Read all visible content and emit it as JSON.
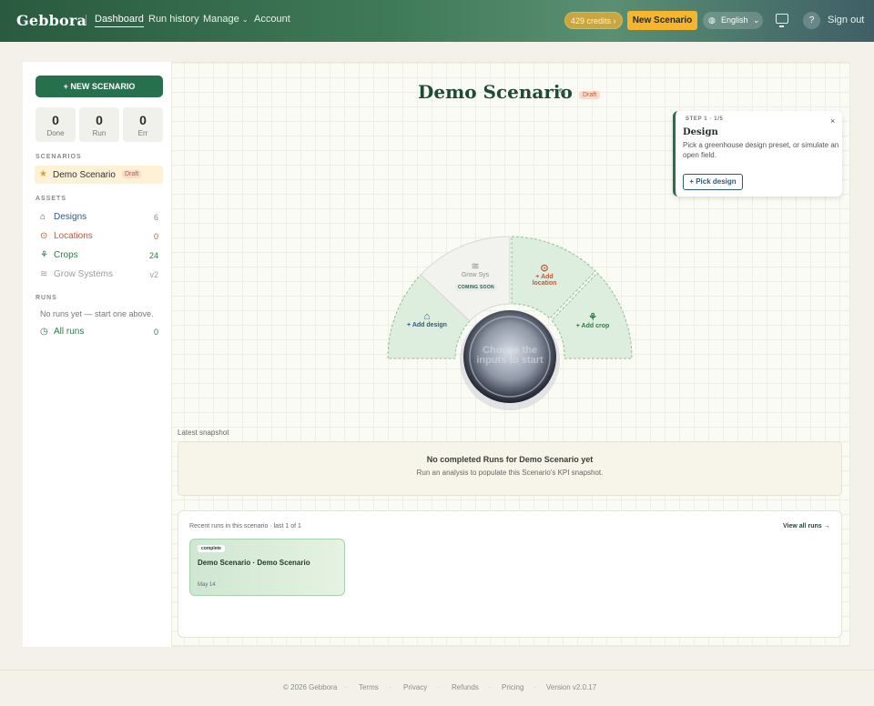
{
  "topbar": {
    "logo": "Gebbora",
    "nav": [
      "Dashboard",
      "Run history",
      "Manage",
      "Account"
    ],
    "credits": "429 credits ›",
    "new_scenario": "New Scenario",
    "language": "English",
    "help": "?",
    "sign_out": "Sign out",
    "brand_color": "#2f6b4c",
    "accent_color": "#f5b52f"
  },
  "sidebar": {
    "new_button": "+ NEW SCENARIO",
    "stats": [
      {
        "value": "0",
        "label": "Done"
      },
      {
        "value": "0",
        "label": "Run"
      },
      {
        "value": "0",
        "label": "Err"
      }
    ],
    "scenarios_heading": "SCENARIOS",
    "scenario": {
      "name": "Demo Scenario",
      "badge": "Draft"
    },
    "assets_heading": "ASSETS",
    "assets": [
      {
        "label": "Designs",
        "count": "6",
        "icon": "greenhouse-icon",
        "color": "#2d5a8a"
      },
      {
        "label": "Locations",
        "count": "0",
        "icon": "pin-icon",
        "color": "#c8553a"
      },
      {
        "label": "Crops",
        "count": "24",
        "icon": "sprout-icon",
        "color": "#2f7a4a"
      },
      {
        "label": "Grow Systems",
        "count": "v2",
        "icon": "layers-icon",
        "color": "#9aa09a"
      }
    ],
    "runs_heading": "RUNS",
    "no_runs": "No runs yet — start one above.",
    "all_runs": {
      "label": "All runs",
      "count": "0"
    }
  },
  "main": {
    "title": "Demo Scenario",
    "badge": "Draft",
    "step": {
      "kicker": "STEP 1 · 1/5",
      "heading": "Design",
      "description": "Pick a greenhouse design preset, or simulate an open field.",
      "button": "+ Pick design",
      "close": "×"
    },
    "wheel": {
      "add_design": "+ Add design",
      "grow_sys": "Grow Sys",
      "coming_soon": "COMING SOON",
      "add_location": "+ Add location",
      "add_crop": "+ Add crop",
      "center": "Choose the inputs to start"
    },
    "snapshot": {
      "label": "Latest snapshot",
      "title": "No completed Runs for Demo Scenario yet",
      "subtitle": "Run an analysis to populate this Scenario's KPI snapshot."
    },
    "recent": {
      "header": "Recent runs in this scenario · last 1 of 1",
      "view_all": "View all runs →",
      "run": {
        "status": "complete",
        "title": "Demo Scenario · Demo Scenario",
        "date": "May 14"
      }
    }
  },
  "footer": {
    "links": [
      "© 2026 Gebbora",
      "Terms",
      "Privacy",
      "Refunds",
      "Pricing",
      "Version v2.0.17"
    ]
  }
}
